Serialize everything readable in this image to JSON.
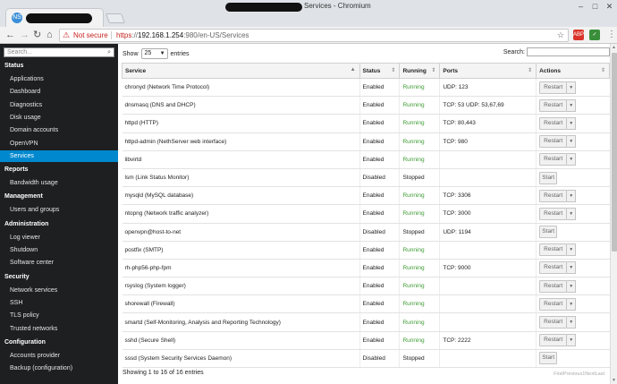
{
  "window": {
    "title": "Services - Chromium",
    "tab_favicon": "NS",
    "minimize": "–",
    "maximize": "□",
    "close": "✕"
  },
  "toolbar": {
    "back": "←",
    "forward": "→",
    "reload": "↻",
    "home": "⌂",
    "security_icon": "⚠",
    "security_label": "Not secure",
    "url_protocol": "https",
    "url_sep": "://",
    "url_host": "192.168.1.254",
    "url_rest": ":980/en-US/Services",
    "star": "☆",
    "ext1_label": "ABP",
    "ext2_label": "✓",
    "menu": "⋮"
  },
  "sidebar": {
    "search_placeholder": "Search...",
    "search_icon": "⌕",
    "sections": [
      {
        "title": "Status",
        "items": [
          "Applications",
          "Dashboard",
          "Diagnostics",
          "Disk usage",
          "Domain accounts",
          "OpenVPN",
          "Services"
        ]
      },
      {
        "title": "Reports",
        "items": [
          "Bandwidth usage"
        ]
      },
      {
        "title": "Management",
        "items": [
          "Users and groups"
        ]
      },
      {
        "title": "Administration",
        "items": [
          "Log viewer",
          "Shutdown",
          "Software center"
        ]
      },
      {
        "title": "Security",
        "items": [
          "Network services",
          "SSH",
          "TLS policy",
          "Trusted networks"
        ]
      },
      {
        "title": "Configuration",
        "items": [
          "Accounts provider",
          "Backup (configuration)"
        ]
      }
    ],
    "active_item": "Services"
  },
  "table_controls": {
    "show_label": "Show",
    "length_value": "25",
    "entries_label": "entries",
    "search_label": "Search:"
  },
  "columns": [
    "Service",
    "Status",
    "Running",
    "Ports",
    "Actions"
  ],
  "rows": [
    {
      "service": "chronyd (Network Time Protocol)",
      "status": "Enabled",
      "running": "Running",
      "ports": "UDP: 123",
      "action": "Restart"
    },
    {
      "service": "dnsmasq (DNS and DHCP)",
      "status": "Enabled",
      "running": "Running",
      "ports": "TCP: 53 UDP: 53,67,69",
      "action": "Restart"
    },
    {
      "service": "httpd (HTTP)",
      "status": "Enabled",
      "running": "Running",
      "ports": "TCP: 80,443",
      "action": "Restart"
    },
    {
      "service": "httpd-admin (NethServer web interface)",
      "status": "Enabled",
      "running": "Running",
      "ports": "TCP: 980",
      "action": "Restart"
    },
    {
      "service": "libvirtd",
      "status": "Enabled",
      "running": "Running",
      "ports": "",
      "action": "Restart"
    },
    {
      "service": "lsm (Link Status Monitor)",
      "status": "Disabled",
      "running": "Stopped",
      "ports": "",
      "action": "Start"
    },
    {
      "service": "mysqld (MySQL database)",
      "status": "Enabled",
      "running": "Running",
      "ports": "TCP: 3306",
      "action": "Restart"
    },
    {
      "service": "ntopng (Network traffic analyzer)",
      "status": "Enabled",
      "running": "Running",
      "ports": "TCP: 3000",
      "action": "Restart"
    },
    {
      "service": "openvpn@host-to-net",
      "status": "Disabled",
      "running": "Stopped",
      "ports": "UDP: 1194",
      "action": "Start"
    },
    {
      "service": "postfix (SMTP)",
      "status": "Enabled",
      "running": "Running",
      "ports": "",
      "action": "Restart"
    },
    {
      "service": "rh-php56-php-fpm",
      "status": "Enabled",
      "running": "Running",
      "ports": "TCP: 9000",
      "action": "Restart"
    },
    {
      "service": "rsyslog (System logger)",
      "status": "Enabled",
      "running": "Running",
      "ports": "",
      "action": "Restart"
    },
    {
      "service": "shorewall (Firewall)",
      "status": "Enabled",
      "running": "Running",
      "ports": "",
      "action": "Restart"
    },
    {
      "service": "smartd (Self-Monitoring, Analysis and Reporting Technology)",
      "status": "Enabled",
      "running": "Running",
      "ports": "",
      "action": "Restart"
    },
    {
      "service": "sshd (Secure Shell)",
      "status": "Enabled",
      "running": "Running",
      "ports": "TCP: 2222",
      "action": "Restart"
    },
    {
      "service": "sssd (System Security Services Daemon)",
      "status": "Disabled",
      "running": "Stopped",
      "ports": "",
      "action": "Start"
    }
  ],
  "footer": {
    "info": "Showing 1 to 16 of 16 entries",
    "pagination": "FirstPrevious1NextLast"
  },
  "colors": {
    "sidebar_bg": "#1d1f20",
    "active": "#0088ce",
    "running": "#3f9c35",
    "insecure": "#c5221f"
  }
}
